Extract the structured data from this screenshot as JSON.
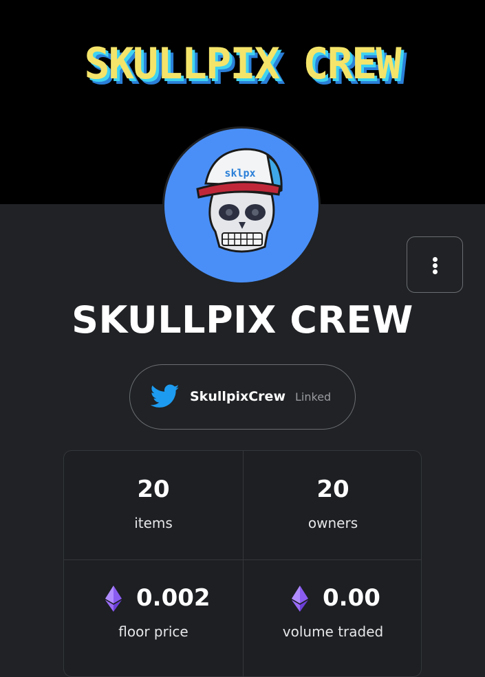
{
  "banner": {
    "logo_text": "SKULLPIX CREW"
  },
  "avatar": {
    "cap_text": "sklpx"
  },
  "collection": {
    "title": "SKULLPIX CREW"
  },
  "twitter": {
    "handle": "SkullpixCrew",
    "status": "Linked"
  },
  "stats": {
    "items_value": "20",
    "items_label": "items",
    "owners_value": "20",
    "owners_label": "owners",
    "floor_value": "0.002",
    "floor_label": "floor price",
    "volume_value": "0.00",
    "volume_label": "volume traded"
  },
  "colors": {
    "banner_bg": "#000000",
    "page_bg": "#202225",
    "avatar_bg": "#4a8ff7",
    "logo_yellow": "#f4e46a",
    "logo_cyan": "#3fd3f0",
    "twitter_blue": "#1d9bf0",
    "eth_purple": "#8a5cf0"
  },
  "icons": {
    "more": "more-vertical-icon",
    "twitter": "twitter-bird-icon",
    "eth": "ethereum-icon"
  }
}
